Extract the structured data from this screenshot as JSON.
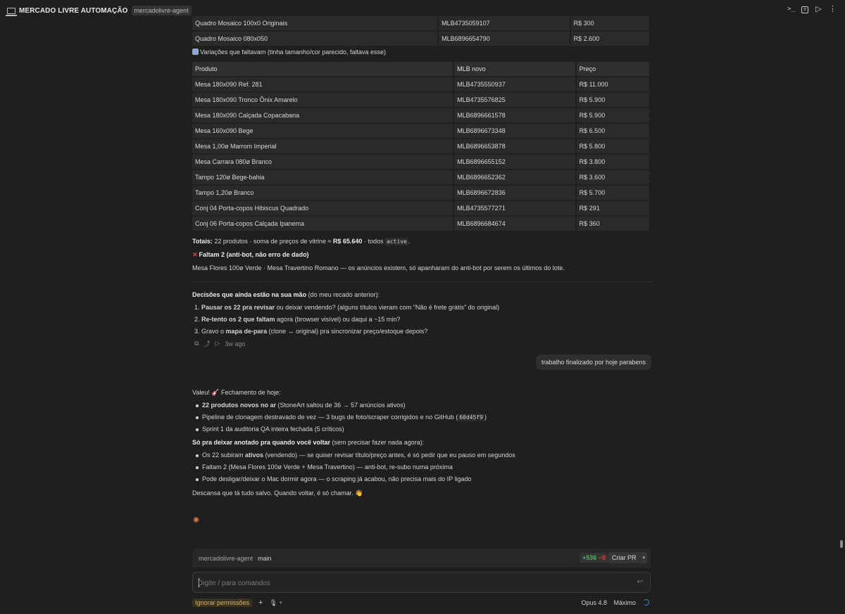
{
  "window": {
    "title": "MERCADO LIVRE AUTOMAÇÃO",
    "badge": "mercadolivre-agent"
  },
  "top_table": {
    "faded_row": [
      "Quadro Mosaico 100x0 Originais",
      "MLB4735059107",
      "R$ 300"
    ],
    "row": [
      "Quadro Mosaico 080x050",
      "MLB6896654790",
      "R$ 2.600"
    ]
  },
  "variations": {
    "heading": "Variações que faltavam (tinha tamanho/cor parecido, faltava esse)",
    "headers": [
      "Produto",
      "MLB novo",
      "Preço"
    ],
    "rows": [
      [
        "Mesa 180x090 Ref. 281",
        "MLB4735550937",
        "R$ 11.000"
      ],
      [
        "Mesa 180x090 Tronco Ônix Amarelo",
        "MLB4735576825",
        "R$ 5.900"
      ],
      [
        "Mesa 180x090 Calçada Copacabana",
        "MLB6896661578",
        "R$ 5.900"
      ],
      [
        "Mesa 160x090 Bege",
        "MLB6896673348",
        "R$ 6.500"
      ],
      [
        "Mesa 1,00ø Marrom Imperial",
        "MLB6896653878",
        "R$ 5.800"
      ],
      [
        "Mesa Carrara 080ø Branco",
        "MLB6896655152",
        "R$ 3.800"
      ],
      [
        "Tampo 120ø Bege-bahia",
        "MLB6896652362",
        "R$ 3.600"
      ],
      [
        "Tampo 1,20ø Branco",
        "MLB6896672836",
        "R$ 5.700"
      ],
      [
        "Conj 04 Porta-copos Hibiscus Quadrado",
        "MLB4735577271",
        "R$ 291"
      ],
      [
        "Conj 06 Porta-copos Calçada Ipanema",
        "MLB6896684674",
        "R$ 360"
      ]
    ]
  },
  "totals": {
    "label": "Totais:",
    "text_a": "22 produtos · soma de preços de vitrine ≈",
    "sum": "R$ 65.640",
    "text_b": "· todos",
    "status": "active",
    "end": "."
  },
  "missing": {
    "heading": "Faltam 2 (anti-bot, não erro de dado)",
    "body": "Mesa Flores 100ø Verde · Mesa Travertino Romano — os anúncios existem, só apanharam do anti-bot por serem os últimos do lote."
  },
  "decisions": {
    "heading_bold": "Decisões que ainda estão na sua mão",
    "heading_rest": " (do meu recado anterior):",
    "items": [
      {
        "n": "1.",
        "bold": "Pausar os 22 pra revisar",
        "rest": " ou deixar vendendo? (alguns títulos vieram com \"Não é frete grátis\" do original)"
      },
      {
        "n": "2.",
        "bold": "Re-tento os 2 que faltam",
        "rest": " agora (browser visível) ou daqui a ~15 min?"
      },
      {
        "n": "3.",
        "pre": "Gravo o ",
        "bold": "mapa de-para",
        "rest": " (clone ↔ original) pra sincronizar preço/estoque depois?"
      }
    ],
    "time": "3w ago"
  },
  "user_message": "trabalho finalizado por hoje parabens",
  "reply": {
    "intro": "Valeu! 🎸 Fechamento de hoje:",
    "bullets1": [
      {
        "bold": "22 produtos novos no ar",
        "rest": " (StoneArt saltou de 36 → 57 anúncios ativos)"
      },
      {
        "pre": "Pipeline de clonagem destravado de vez — 3 bugs de foto/scraper corrigidos e no GitHub (",
        "code": "60d45f9",
        "post": ")"
      },
      {
        "pre": "Sprint 1 da auditoria QA inteira fechada (5 críticos)"
      }
    ],
    "note_bold": "Só pra deixar anotado pra quando você voltar",
    "note_rest": " (sem precisar fazer nada agora):",
    "bullets2": [
      {
        "pre": "Os 22 subiram ",
        "bold": "ativos",
        "rest": " (vendendo) — se quiser revisar título/preço antes, é só pedir que eu pauso em segundos"
      },
      {
        "pre": "Faltam 2 (Mesa Flores 100ø Verde + Mesa Travertino) — anti-bot, re-subo numa próxima"
      },
      {
        "pre": "Pode desligar/deixar o Mac dormir agora — o scraping já acabou, não precisa mais do IP ligado"
      }
    ],
    "closing": "Descansa que tá tudo salvo. Quando voltar, é só chamar. 👋"
  },
  "composer": {
    "repo": "mercadolivre-agent",
    "branch": "main",
    "additions": "+536",
    "deletions": "−0",
    "create_pr": "Criar PR",
    "placeholder": "Digite / para comandos",
    "permissions": "Ignorar permissões",
    "model": "Opus 4.8",
    "effort": "Máximo"
  },
  "colors": {
    "background": "#1f1f1f",
    "accent_warning": "#e2b25a",
    "added": "#4fb35d",
    "removed": "#e0443a"
  }
}
